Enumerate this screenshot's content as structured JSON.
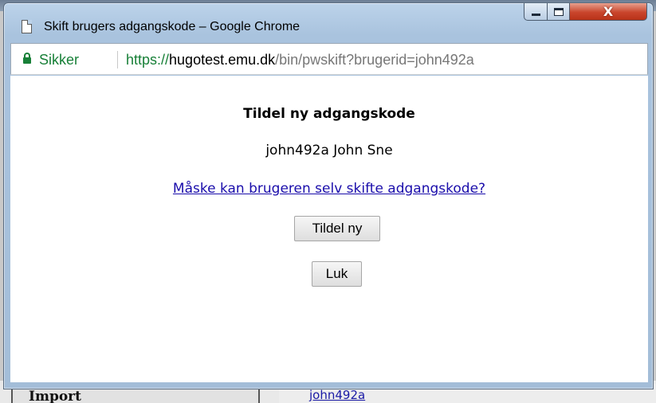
{
  "background": {
    "sidebar_label": "Import",
    "link_text": "john492a"
  },
  "window": {
    "title": "Skift brugers adgangskode – Google Chrome",
    "controls": {
      "minimize": "–",
      "maximize": "□",
      "close": "X"
    }
  },
  "addressbar": {
    "secure_label": "Sikker",
    "url_scheme": "https://",
    "url_host": "hugotest.emu.dk",
    "url_path": "/bin/pwskift?brugerid=john492a"
  },
  "dialog": {
    "heading": "Tildel ny adgangskode",
    "user_line": "john492a John Sne",
    "self_change_link": "Måske kan brugeren selv skifte adgangskode?",
    "assign_button": "Tildel ny",
    "close_button": "Luk"
  },
  "colors": {
    "secure_green": "#188038",
    "link_blue": "#1a0dab",
    "close_red": "#c9452c"
  },
  "icons": [
    "page-icon",
    "lock-icon",
    "minimize-icon",
    "maximize-icon",
    "close-icon"
  ]
}
